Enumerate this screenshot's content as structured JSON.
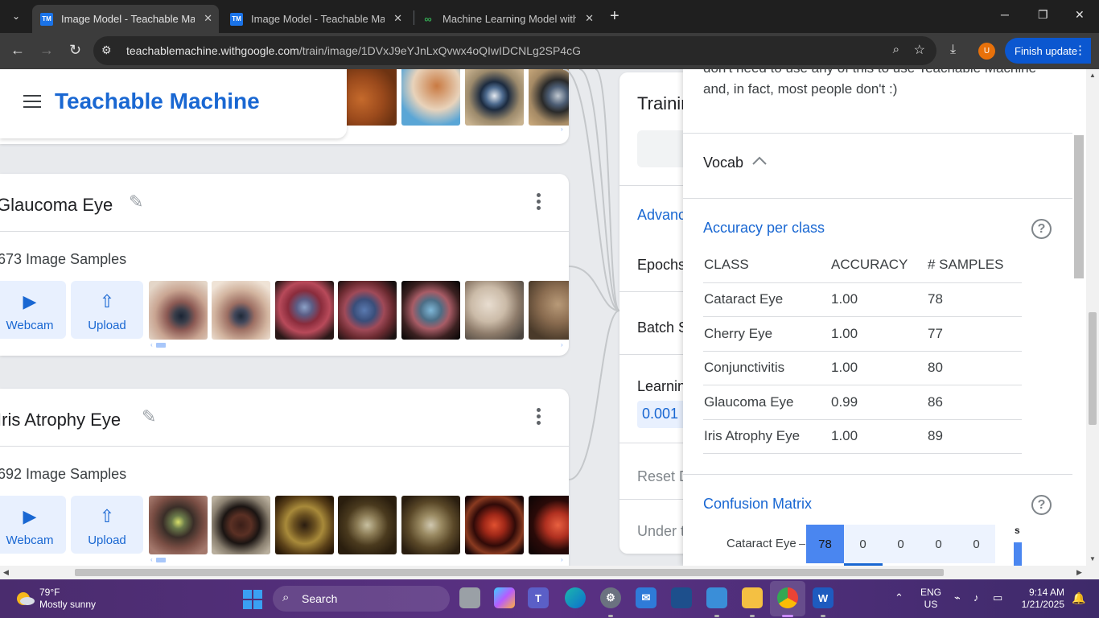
{
  "browser": {
    "tabs": [
      {
        "title": "Image Model - Teachable Machine",
        "favicon": "TM",
        "active": true
      },
      {
        "title": "Image Model - Teachable Machine",
        "favicon": "TM",
        "active": false
      },
      {
        "title": "Machine Learning Model with Teachable Machine",
        "favicon": "∞",
        "active": false
      }
    ],
    "url_host": "teachablemachine.withgoogle.com",
    "url_path": "/train/image/1DVxJ9eYJnLxQvwx4oQIwIDCNLg2SP4cG",
    "profile_initial": "U",
    "finish_update": "Finish update"
  },
  "app": {
    "logo": "Teachable Machine"
  },
  "classes": [
    {
      "name": "Glaucoma Eye",
      "samples": "673 Image Samples",
      "webcam": "Webcam",
      "upload": "Upload"
    },
    {
      "name": "Iris Atrophy Eye",
      "samples": "692 Image Samples",
      "webcam": "Webcam",
      "upload": "Upload"
    }
  ],
  "training": {
    "title": "Training",
    "advanced": "Advanced",
    "epochs": "Epochs",
    "batch_size": "Batch Size",
    "learning_rate": "Learning Rate",
    "learning_rate_value": "0.001",
    "reset": "Reset Defaults",
    "under_the_hood": "Under the hood"
  },
  "panel": {
    "intro": "don't need to use any of this to use Teachable Machine and, in fact, most people don't :)",
    "vocab": "Vocab",
    "accuracy_title": "Accuracy per class",
    "columns": [
      "CLASS",
      "ACCURACY",
      "# SAMPLES"
    ],
    "rows": [
      [
        "Cataract Eye",
        "1.00",
        "78"
      ],
      [
        "Cherry Eye",
        "1.00",
        "77"
      ],
      [
        "Conjunctivitis",
        "1.00",
        "80"
      ],
      [
        "Glaucoma Eye",
        "0.99",
        "86"
      ],
      [
        "Iris Atrophy Eye",
        "1.00",
        "89"
      ]
    ],
    "confusion_title": "Confusion Matrix",
    "confusion_row_label": "Cataract Eye",
    "confusion_row_values": [
      "78",
      "0",
      "0",
      "0",
      "0"
    ],
    "confusion_axis_letter": "s"
  },
  "taskbar": {
    "temp": "79°F",
    "weather": "Mostly sunny",
    "search": "Search",
    "lang1": "ENG",
    "lang2": "US",
    "time": "9:14 AM",
    "date": "1/21/2025"
  }
}
